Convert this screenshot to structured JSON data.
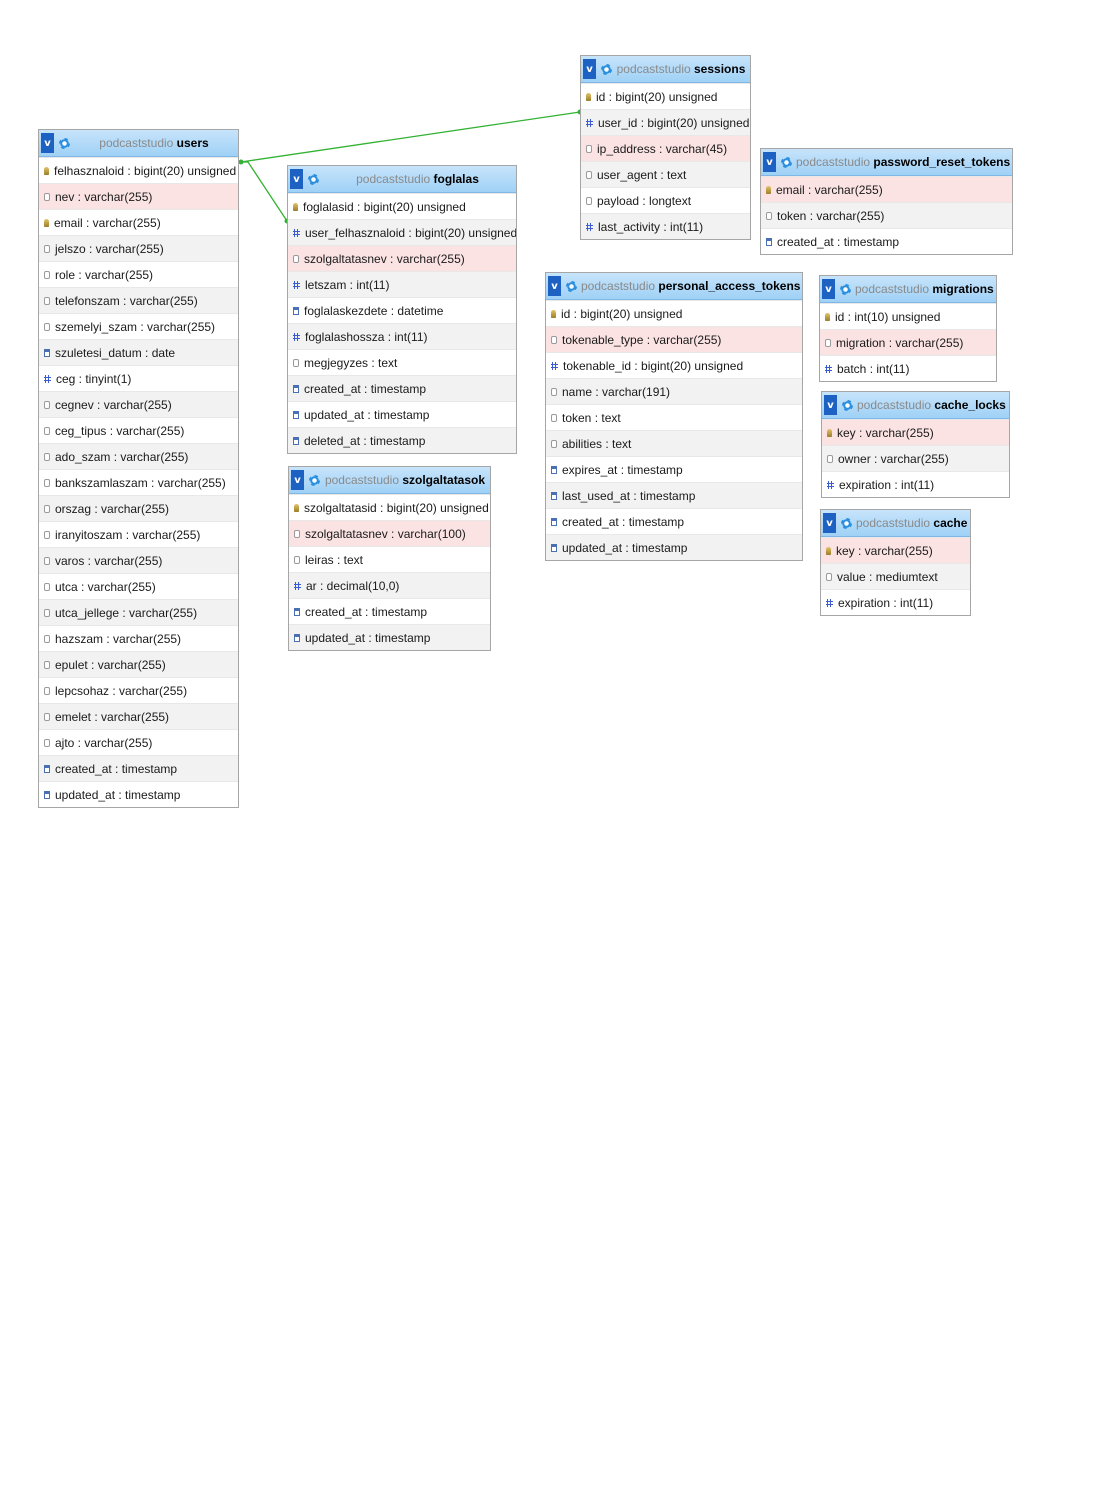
{
  "database": "podcaststudio",
  "toggle_label": "v",
  "tables": {
    "users": {
      "name": "users",
      "columns": [
        {
          "text": "felhasznaloid : bigint(20) unsigned",
          "icon": "key"
        },
        {
          "text": "nev : varchar(255)",
          "icon": "txt"
        },
        {
          "text": "email : varchar(255)",
          "icon": "key"
        },
        {
          "text": "jelszo : varchar(255)",
          "icon": "txt"
        },
        {
          "text": "role : varchar(255)",
          "icon": "txt"
        },
        {
          "text": "telefonszam : varchar(255)",
          "icon": "txt"
        },
        {
          "text": "szemelyi_szam : varchar(255)",
          "icon": "txt"
        },
        {
          "text": "szuletesi_datum : date",
          "icon": "date"
        },
        {
          "text": "ceg : tinyint(1)",
          "icon": "num"
        },
        {
          "text": "cegnev : varchar(255)",
          "icon": "txt"
        },
        {
          "text": "ceg_tipus : varchar(255)",
          "icon": "txt"
        },
        {
          "text": "ado_szam : varchar(255)",
          "icon": "txt"
        },
        {
          "text": "bankszamlaszam : varchar(255)",
          "icon": "txt"
        },
        {
          "text": "orszag : varchar(255)",
          "icon": "txt"
        },
        {
          "text": "iranyitoszam : varchar(255)",
          "icon": "txt"
        },
        {
          "text": "varos : varchar(255)",
          "icon": "txt"
        },
        {
          "text": "utca : varchar(255)",
          "icon": "txt"
        },
        {
          "text": "utca_jellege : varchar(255)",
          "icon": "txt"
        },
        {
          "text": "hazszam : varchar(255)",
          "icon": "txt"
        },
        {
          "text": "epulet : varchar(255)",
          "icon": "txt"
        },
        {
          "text": "lepcsohaz : varchar(255)",
          "icon": "txt"
        },
        {
          "text": "emelet : varchar(255)",
          "icon": "txt"
        },
        {
          "text": "ajto : varchar(255)",
          "icon": "txt"
        },
        {
          "text": "created_at : timestamp",
          "icon": "date"
        },
        {
          "text": "updated_at : timestamp",
          "icon": "date"
        }
      ]
    },
    "foglalas": {
      "name": "foglalas",
      "columns": [
        {
          "text": "foglalasid : bigint(20) unsigned",
          "icon": "key"
        },
        {
          "text": "user_felhasznaloid : bigint(20) unsigned",
          "icon": "num"
        },
        {
          "text": "szolgaltatasnev : varchar(255)",
          "icon": "txt"
        },
        {
          "text": "letszam : int(11)",
          "icon": "num"
        },
        {
          "text": "foglalaskezdete : datetime",
          "icon": "date"
        },
        {
          "text": "foglalashossza : int(11)",
          "icon": "num"
        },
        {
          "text": "megjegyzes : text",
          "icon": "txt"
        },
        {
          "text": "created_at : timestamp",
          "icon": "date"
        },
        {
          "text": "updated_at : timestamp",
          "icon": "date"
        },
        {
          "text": "deleted_at : timestamp",
          "icon": "date"
        }
      ]
    },
    "szolgaltatasok": {
      "name": "szolgaltatasok",
      "columns": [
        {
          "text": "szolgaltatasid : bigint(20) unsigned",
          "icon": "key"
        },
        {
          "text": "szolgaltatasnev : varchar(100)",
          "icon": "txt"
        },
        {
          "text": "leiras : text",
          "icon": "txt"
        },
        {
          "text": "ar : decimal(10,0)",
          "icon": "num"
        },
        {
          "text": "created_at : timestamp",
          "icon": "date"
        },
        {
          "text": "updated_at : timestamp",
          "icon": "date"
        }
      ]
    },
    "sessions": {
      "name": "sessions",
      "columns": [
        {
          "text": "id : bigint(20) unsigned",
          "icon": "key"
        },
        {
          "text": "user_id : bigint(20) unsigned",
          "icon": "num"
        },
        {
          "text": "ip_address : varchar(45)",
          "icon": "txt"
        },
        {
          "text": "user_agent : text",
          "icon": "txt"
        },
        {
          "text": "payload : longtext",
          "icon": "txt"
        },
        {
          "text": "last_activity : int(11)",
          "icon": "num"
        }
      ]
    },
    "password_reset_tokens": {
      "name": "password_reset_tokens",
      "columns": [
        {
          "text": "email : varchar(255)",
          "icon": "key"
        },
        {
          "text": "token : varchar(255)",
          "icon": "txt"
        },
        {
          "text": "created_at : timestamp",
          "icon": "date"
        }
      ]
    },
    "personal_access_tokens": {
      "name": "personal_access_tokens",
      "columns": [
        {
          "text": "id : bigint(20) unsigned",
          "icon": "key"
        },
        {
          "text": "tokenable_type : varchar(255)",
          "icon": "txt"
        },
        {
          "text": "tokenable_id : bigint(20) unsigned",
          "icon": "num"
        },
        {
          "text": "name : varchar(191)",
          "icon": "txt"
        },
        {
          "text": "token : text",
          "icon": "txt"
        },
        {
          "text": "abilities : text",
          "icon": "txt"
        },
        {
          "text": "expires_at : timestamp",
          "icon": "date"
        },
        {
          "text": "last_used_at : timestamp",
          "icon": "date"
        },
        {
          "text": "created_at : timestamp",
          "icon": "date"
        },
        {
          "text": "updated_at : timestamp",
          "icon": "date"
        }
      ]
    },
    "migrations": {
      "name": "migrations",
      "columns": [
        {
          "text": "id : int(10) unsigned",
          "icon": "key"
        },
        {
          "text": "migration : varchar(255)",
          "icon": "txt"
        },
        {
          "text": "batch : int(11)",
          "icon": "num"
        }
      ]
    },
    "cache_locks": {
      "name": "cache_locks",
      "columns": [
        {
          "text": "key : varchar(255)",
          "icon": "key"
        },
        {
          "text": "owner : varchar(255)",
          "icon": "txt"
        },
        {
          "text": "expiration : int(11)",
          "icon": "num"
        }
      ]
    },
    "cache": {
      "name": "cache",
      "columns": [
        {
          "text": "key : varchar(255)",
          "icon": "key"
        },
        {
          "text": "value : mediumtext",
          "icon": "txt"
        },
        {
          "text": "expiration : int(11)",
          "icon": "num"
        }
      ]
    }
  },
  "relations": [
    {
      "from": "users.felhasznaloid",
      "to": "sessions.user_id"
    },
    {
      "from": "users.felhasznaloid",
      "to": "foglalas.user_felhasznaloid"
    }
  ],
  "colors": {
    "relation_line": "#33b233",
    "header": "#a9d6f7",
    "highlight_row": "#fbe3e3"
  }
}
